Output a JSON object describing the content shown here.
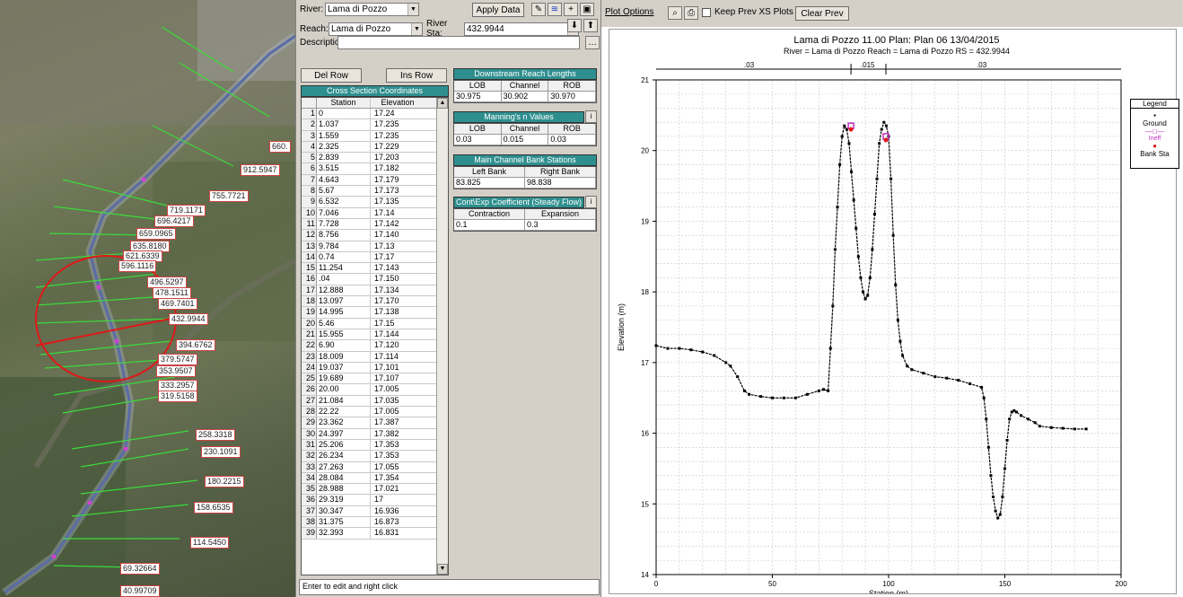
{
  "map": {
    "labels": [
      {
        "text": "660."
      },
      {
        "text": "912.5947"
      },
      {
        "text": "755.7721"
      },
      {
        "text": "719.1171"
      },
      {
        "text": "696.4217"
      },
      {
        "text": "659.0965"
      },
      {
        "text": "635.8180"
      },
      {
        "text": "621.6339"
      },
      {
        "text": "596.1116"
      },
      {
        "text": "496.5297"
      },
      {
        "text": "478.1511"
      },
      {
        "text": "469.7401"
      },
      {
        "text": "432.9944"
      },
      {
        "text": "394.6762"
      },
      {
        "text": "379.5747"
      },
      {
        "text": "353.9507"
      },
      {
        "text": "333.2957"
      },
      {
        "text": "319.5158"
      },
      {
        "text": "258.3318"
      },
      {
        "text": "230.1091"
      },
      {
        "text": "180.2215"
      },
      {
        "text": "158.6535"
      },
      {
        "text": "114.5450"
      },
      {
        "text": "69.32664"
      },
      {
        "text": "40.99709"
      }
    ]
  },
  "editor": {
    "river_label": "River:",
    "river_value": "Lama di Pozzo",
    "reach_label": "Reach:",
    "reach_value": "Lama di Pozzo",
    "river_sta_label": "River Sta:",
    "river_sta_value": "432.9944",
    "apply_data_label": "Apply Data",
    "description_label": "Description",
    "del_row_label": "Del Row",
    "ins_row_label": "Ins Row",
    "xs_title": "Cross Section Coordinates",
    "xs_col_station": "Station",
    "xs_col_elevation": "Elevation",
    "xs_rows": [
      [
        "1",
        "0",
        "17.24"
      ],
      [
        "2",
        "1.037",
        "17.235"
      ],
      [
        "3",
        "1.559",
        "17.235"
      ],
      [
        "4",
        "2.325",
        "17.229"
      ],
      [
        "5",
        "2.839",
        "17.203"
      ],
      [
        "6",
        "3.515",
        "17.182"
      ],
      [
        "7",
        "4.643",
        "17.179"
      ],
      [
        "8",
        "5.67",
        "17.173"
      ],
      [
        "9",
        "6.532",
        "17.135"
      ],
      [
        "10",
        "7.046",
        "17.14"
      ],
      [
        "11",
        "7.728",
        "17.142"
      ],
      [
        "12",
        "8.756",
        "17.140"
      ],
      [
        "13",
        "9.784",
        "17.13"
      ],
      [
        "14",
        "0.74",
        "17.17"
      ],
      [
        "15",
        "11.254",
        "17.143"
      ],
      [
        "16",
        ".04",
        "17.150"
      ],
      [
        "17",
        "12.888",
        "17.134"
      ],
      [
        "18",
        "13.097",
        "17.170"
      ],
      [
        "19",
        "14.995",
        "17.138"
      ],
      [
        "20",
        "5.46",
        "17.15"
      ],
      [
        "21",
        "15.955",
        "17.144"
      ],
      [
        "22",
        "6.90",
        "17.120"
      ],
      [
        "23",
        "18.009",
        "17.114"
      ],
      [
        "24",
        "19.037",
        "17.101"
      ],
      [
        "25",
        "19.689",
        "17.107"
      ],
      [
        "26",
        "20.00",
        "17.005"
      ],
      [
        "27",
        "21.084",
        "17.035"
      ],
      [
        "28",
        "22.22",
        "17.005"
      ],
      [
        "29",
        "23.362",
        "17.387"
      ],
      [
        "30",
        "24.397",
        "17.382"
      ],
      [
        "31",
        "25.206",
        "17.353"
      ],
      [
        "32",
        "26.234",
        "17.353"
      ],
      [
        "33",
        "27.263",
        "17.055"
      ],
      [
        "34",
        "28.084",
        "17.354"
      ],
      [
        "35",
        "28.988",
        "17.021"
      ],
      [
        "36",
        "29.319",
        "17"
      ],
      [
        "37",
        "30.347",
        "16.936"
      ],
      [
        "38",
        "31.375",
        "16.873"
      ],
      [
        "39",
        "32.393",
        "16.831"
      ]
    ],
    "downstream_title": "Downstream Reach Lengths",
    "ds_cols": [
      "LOB",
      "Channel",
      "ROB"
    ],
    "ds_values": [
      "30.975",
      "30.902",
      "30.970"
    ],
    "manning_title": "Manning's n Values",
    "manning_cols": [
      "LOB",
      "Channel",
      "ROB"
    ],
    "manning_values": [
      "0.03",
      "0.015",
      "0.03"
    ],
    "bank_title": "Main Channel Bank Stations",
    "bank_cols": [
      "Left Bank",
      "Right Bank"
    ],
    "bank_values": [
      "83.825",
      "98.838"
    ],
    "coeff_title": "Cont\\Exp Coefficient (Steady Flow)",
    "coeff_cols": [
      "Contraction",
      "Expansion"
    ],
    "coeff_values": [
      "0.1",
      "0.3"
    ],
    "description_text": "Enter to edit and right click"
  },
  "plot": {
    "toolbar_plot_options": "Plot Options",
    "toolbar_keep_prev": "Keep Prev XS Plots",
    "toolbar_clear_prev": "Clear Prev",
    "title_line1": "Lama di Pozzo 11.00    Plan: Plan 06    13/04/2015",
    "title_line2": "River = Lama di Pozzo   Reach = Lama di Pozzo     RS = 432.9944",
    "legend_title": "Legend",
    "legend_ground": "Ground",
    "legend_ineff": "Ineff",
    "legend_bank": "Bank Sta",
    "top_n_labels": [
      ".03",
      ".015",
      ".03"
    ]
  },
  "chart_data": {
    "type": "line",
    "title": "Lama di Pozzo 11.00    Plan: Plan 06    13/04/2015",
    "xlabel": "Station (m)",
    "ylabel": "Elevation (m)",
    "xlim": [
      0,
      200
    ],
    "ylim": [
      14,
      21
    ],
    "xticks": [
      0,
      50,
      100,
      150,
      200
    ],
    "yticks": [
      14,
      15,
      16,
      17,
      18,
      19,
      20,
      21
    ],
    "series": [
      {
        "name": "Ground",
        "x": [
          0,
          5,
          10,
          15,
          20,
          25,
          30,
          32,
          35,
          38,
          40,
          45,
          50,
          55,
          60,
          65,
          70,
          72,
          74,
          75,
          76,
          77,
          78,
          79,
          80,
          81,
          82,
          83,
          84,
          85,
          86,
          87,
          88,
          89,
          90,
          91,
          92,
          93,
          94,
          95,
          96,
          97,
          98,
          99,
          100,
          101,
          102,
          103,
          104,
          105,
          106,
          108,
          110,
          115,
          120,
          125,
          130,
          135,
          140,
          141,
          142,
          143,
          144,
          145,
          146,
          147,
          148,
          149,
          150,
          151,
          152,
          153,
          154,
          155,
          157,
          160,
          163,
          165,
          170,
          175,
          180,
          185
        ],
        "y": [
          17.24,
          17.2,
          17.2,
          17.18,
          17.15,
          17.1,
          17.0,
          16.95,
          16.8,
          16.6,
          16.55,
          16.52,
          16.5,
          16.5,
          16.5,
          16.55,
          16.6,
          16.62,
          16.6,
          17.2,
          17.8,
          18.6,
          19.2,
          19.8,
          20.2,
          20.35,
          20.3,
          20.1,
          19.7,
          19.3,
          18.9,
          18.5,
          18.2,
          18.0,
          17.9,
          17.95,
          18.2,
          18.6,
          19.1,
          19.6,
          20.1,
          20.3,
          20.4,
          20.35,
          20.2,
          19.6,
          18.8,
          18.1,
          17.6,
          17.3,
          17.1,
          16.95,
          16.9,
          16.85,
          16.8,
          16.78,
          16.75,
          16.7,
          16.65,
          16.5,
          16.2,
          15.8,
          15.4,
          15.1,
          14.9,
          14.8,
          14.85,
          15.1,
          15.5,
          15.9,
          16.2,
          16.3,
          16.32,
          16.3,
          16.25,
          16.2,
          16.15,
          16.1,
          16.08,
          16.07,
          16.06,
          16.06
        ]
      }
    ],
    "bank_stations": [
      [
        83.825,
        20.35
      ],
      [
        98.838,
        20.2
      ]
    ]
  }
}
